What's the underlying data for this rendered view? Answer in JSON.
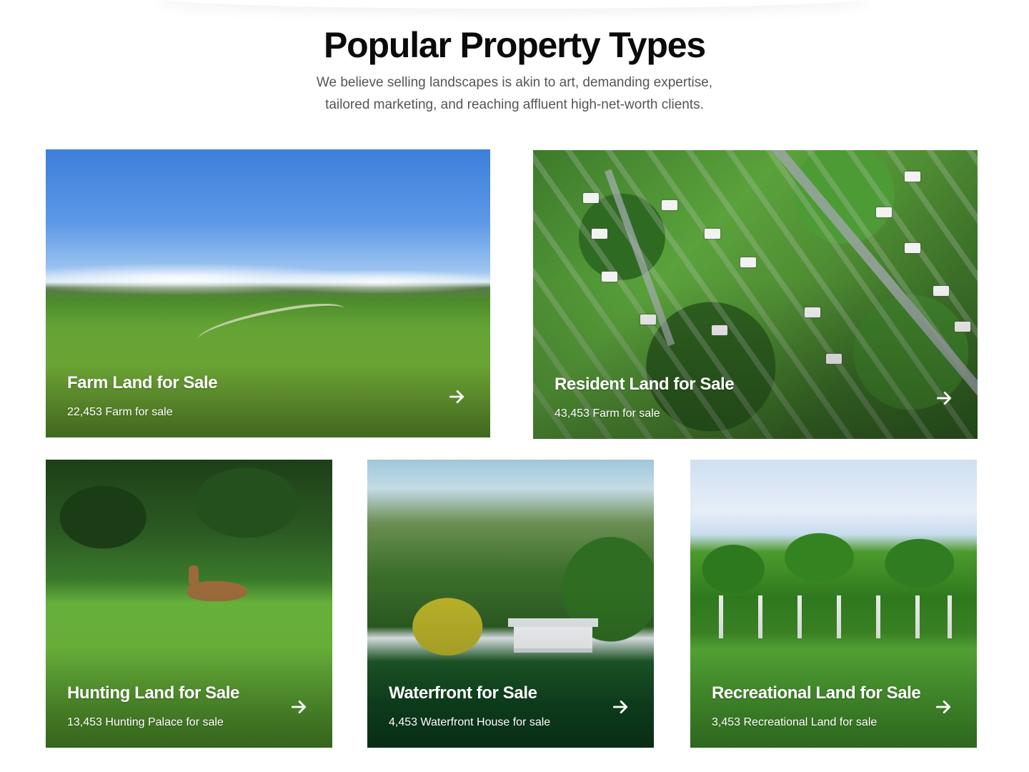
{
  "section": {
    "title": "Popular Property Types",
    "subtitle_line1": "We believe selling landscapes is akin to art, demanding expertise,",
    "subtitle_line2": "tailored marketing, and reaching affluent high-net-worth clients."
  },
  "cards": [
    {
      "id": "farm",
      "title": "Farm Land for Sale",
      "count": "22,453 Farm for sale",
      "icon": "arrow-right-icon"
    },
    {
      "id": "resident",
      "title": "Resident Land for Sale",
      "count": "43,453 Farm for sale",
      "icon": "arrow-right-icon"
    },
    {
      "id": "hunting",
      "title": "Hunting Land for Sale",
      "count": "13,453 Hunting Palace for sale",
      "icon": "arrow-right-icon"
    },
    {
      "id": "waterfront",
      "title": "Waterfront for Sale",
      "count": "4,453 Waterfront House for sale",
      "icon": "arrow-right-icon"
    },
    {
      "id": "recreational",
      "title": "Recreational Land for Sale",
      "count": "3,453 Recreational Land for sale",
      "icon": "arrow-right-icon"
    }
  ],
  "colors": {
    "title": "#0b0b0b",
    "subtitle": "#555555",
    "card_text": "#ffffff"
  }
}
